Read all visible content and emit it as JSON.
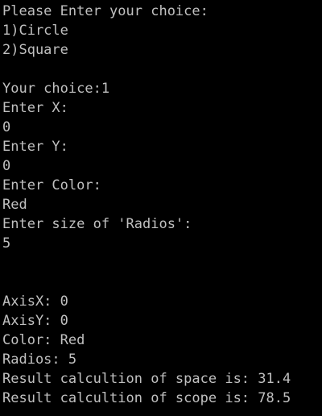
{
  "console": {
    "text_color": "#C0C0C0",
    "background_color": "#000000",
    "lines": [
      "Please Enter your choice:",
      "1)Circle",
      "2)Square",
      "",
      "Your choice:1",
      "Enter X:",
      "0",
      "Enter Y:",
      "0",
      "Enter Color:",
      "Red",
      "Enter size of 'Radios':",
      "5",
      "",
      "",
      "AxisX: 0",
      "AxisY: 0",
      "Color: Red",
      "Radios: 5",
      "Result calcultion of space is: 31.4",
      "Result calcultion of scope is: 78.5"
    ]
  }
}
